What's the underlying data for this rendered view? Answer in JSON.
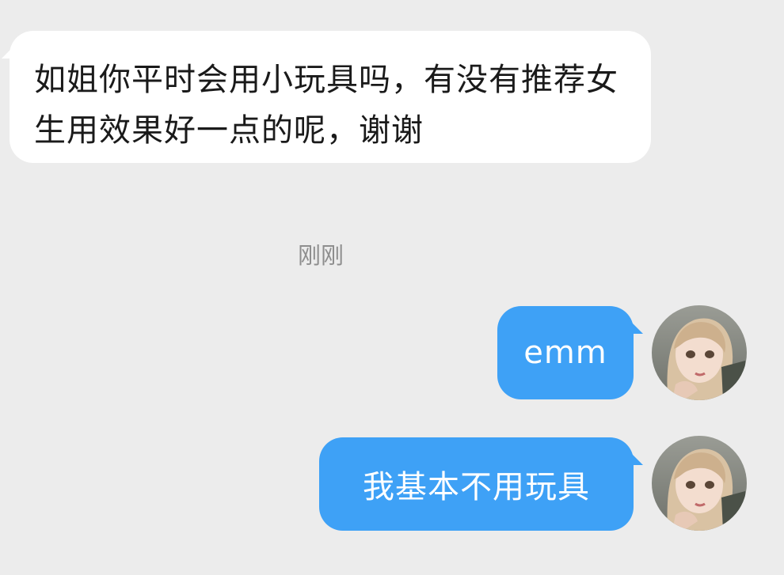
{
  "conversation": {
    "incoming": [
      {
        "text": "如姐你平时会用小玩具吗，有没有推荐女生用效果好一点的呢，谢谢"
      }
    ],
    "timestamp": "刚刚",
    "outgoing": [
      {
        "text": "emm"
      },
      {
        "text": "我基本不用玩具"
      }
    ]
  },
  "colors": {
    "background": "#ececec",
    "incoming_bubble": "#ffffff",
    "outgoing_bubble": "#3ea1f6",
    "timestamp_text": "#8e8e8e"
  },
  "icons": {
    "avatar": "user-avatar-illustration"
  }
}
